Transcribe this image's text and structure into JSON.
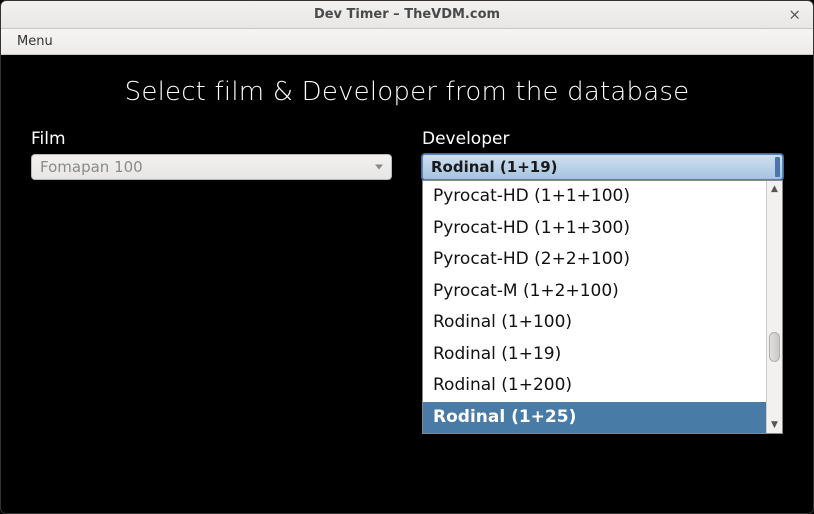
{
  "window": {
    "title": "Dev Timer – TheVDM.com",
    "close_glyph": "×"
  },
  "menubar": {
    "menu": "Menu"
  },
  "heading": "Select film & Developer from the database",
  "film": {
    "label": "Film",
    "value": "Fomapan 100"
  },
  "developer": {
    "label": "Developer",
    "value": "Rodinal (1+19)",
    "options": [
      "Pyrocat-HD (1+1+100)",
      "Pyrocat-HD (1+1+300)",
      "Pyrocat-HD (2+2+100)",
      "Pyrocat-M (1+2+100)",
      "Rodinal (1+100)",
      "Rodinal (1+19)",
      "Rodinal (1+200)",
      "Rodinal (1+25)"
    ],
    "highlight_index": 7
  },
  "scroll": {
    "up_glyph": "▲",
    "down_glyph": "▼"
  }
}
